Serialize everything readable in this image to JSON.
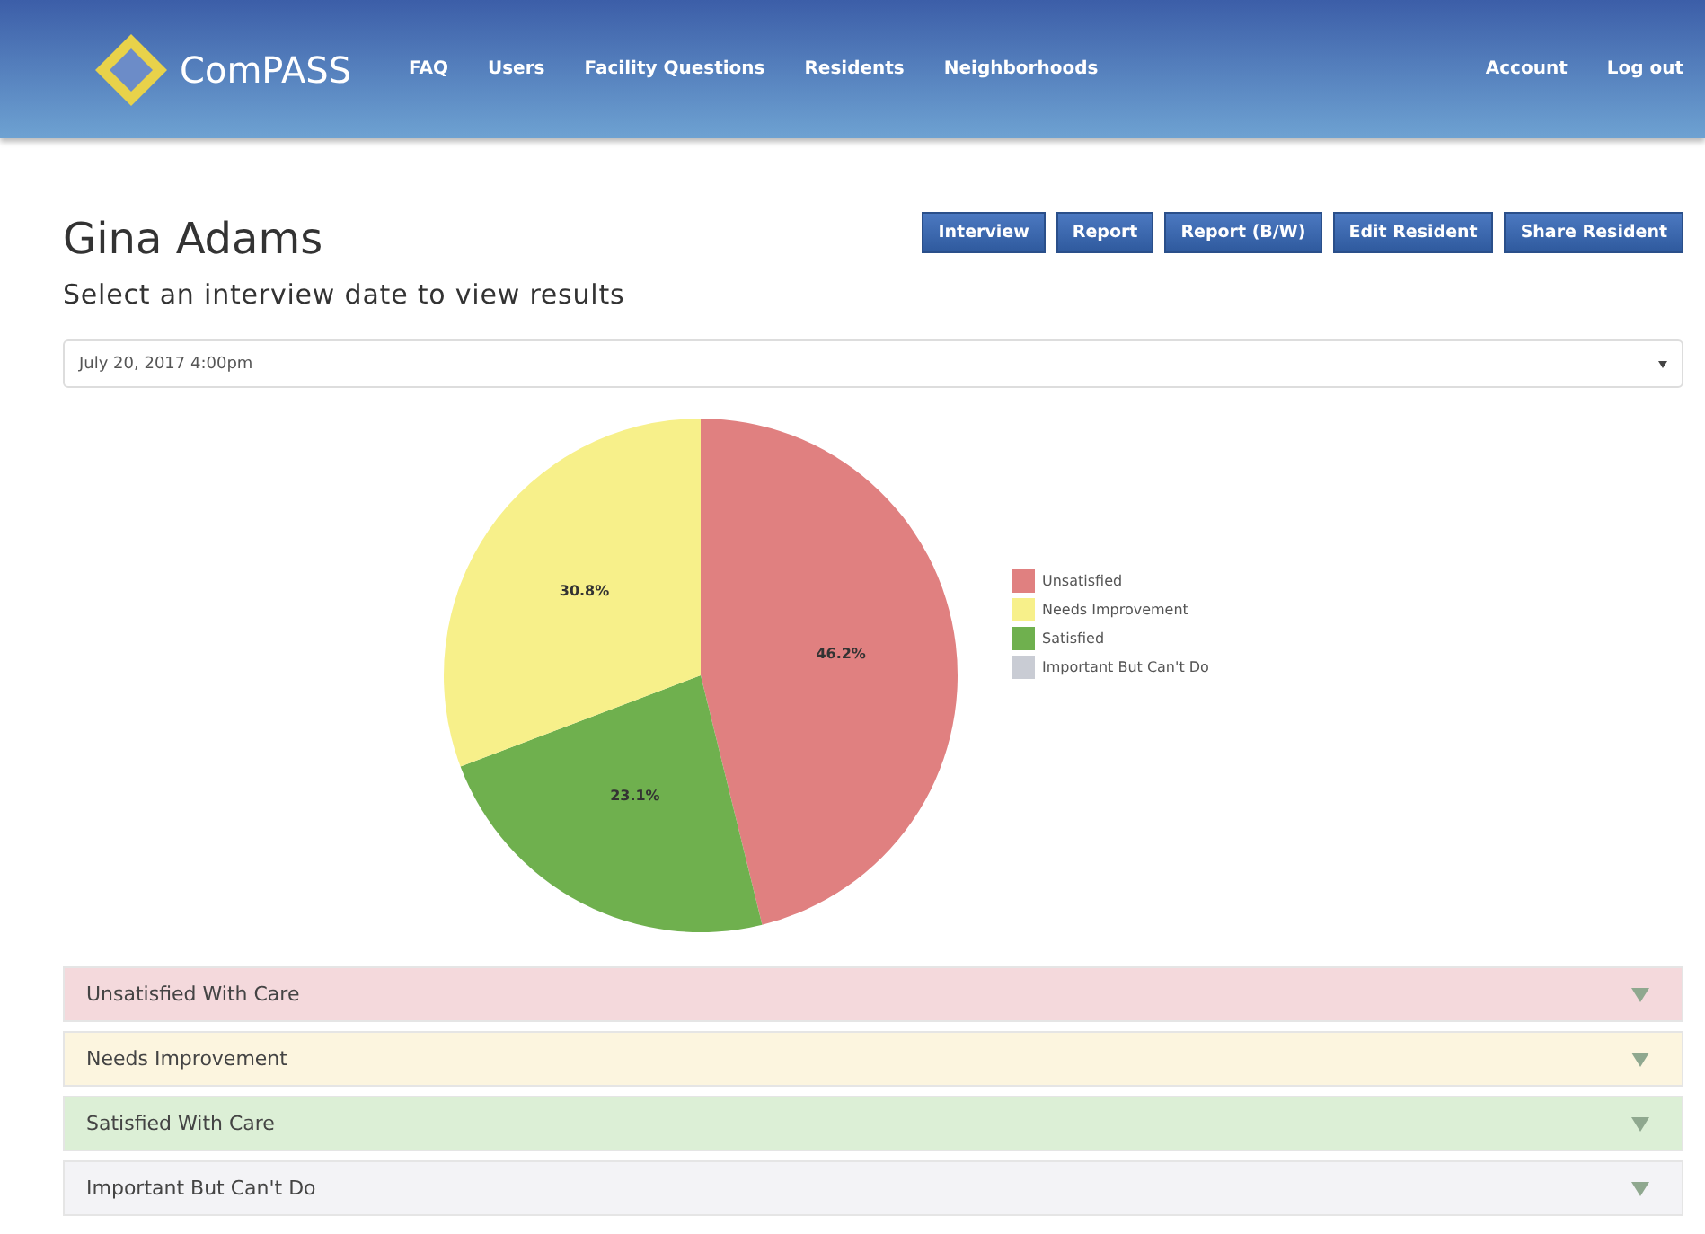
{
  "navbar": {
    "brand": "ComPASS",
    "links": [
      "FAQ",
      "Users",
      "Facility Questions",
      "Residents",
      "Neighborhoods"
    ],
    "account_links": [
      "Account",
      "Log out"
    ]
  },
  "resident": {
    "name": "Gina Adams",
    "subtitle": "Select an interview date to view results"
  },
  "actions": [
    "Interview",
    "Report",
    "Report (B/W)",
    "Edit Resident",
    "Share Resident"
  ],
  "date_select": {
    "value": "July 20, 2017 4:00pm"
  },
  "chart_data": {
    "type": "pie",
    "categories": [
      "Unsatisfied",
      "Needs Improvement",
      "Satisfied",
      "Important But Can't Do"
    ],
    "values": [
      46.2,
      30.8,
      23.1,
      0
    ],
    "colors": [
      "#e08080",
      "#f7f08a",
      "#6fb04e",
      "#c9ccd4"
    ],
    "value_labels": [
      "46.2%",
      "30.8%",
      "23.1%",
      null
    ]
  },
  "sections": [
    {
      "title": "Unsatisfied With Care",
      "color": "#f4d9dc",
      "expanded": false
    },
    {
      "title": "Needs Improvement",
      "color": "#fcf5df",
      "expanded": false
    },
    {
      "title": "Satisfied With Care",
      "color": "#dcefd6",
      "expanded": false
    },
    {
      "title": "Important But Can't Do",
      "color": "#f3f3f6",
      "expanded": false
    }
  ]
}
